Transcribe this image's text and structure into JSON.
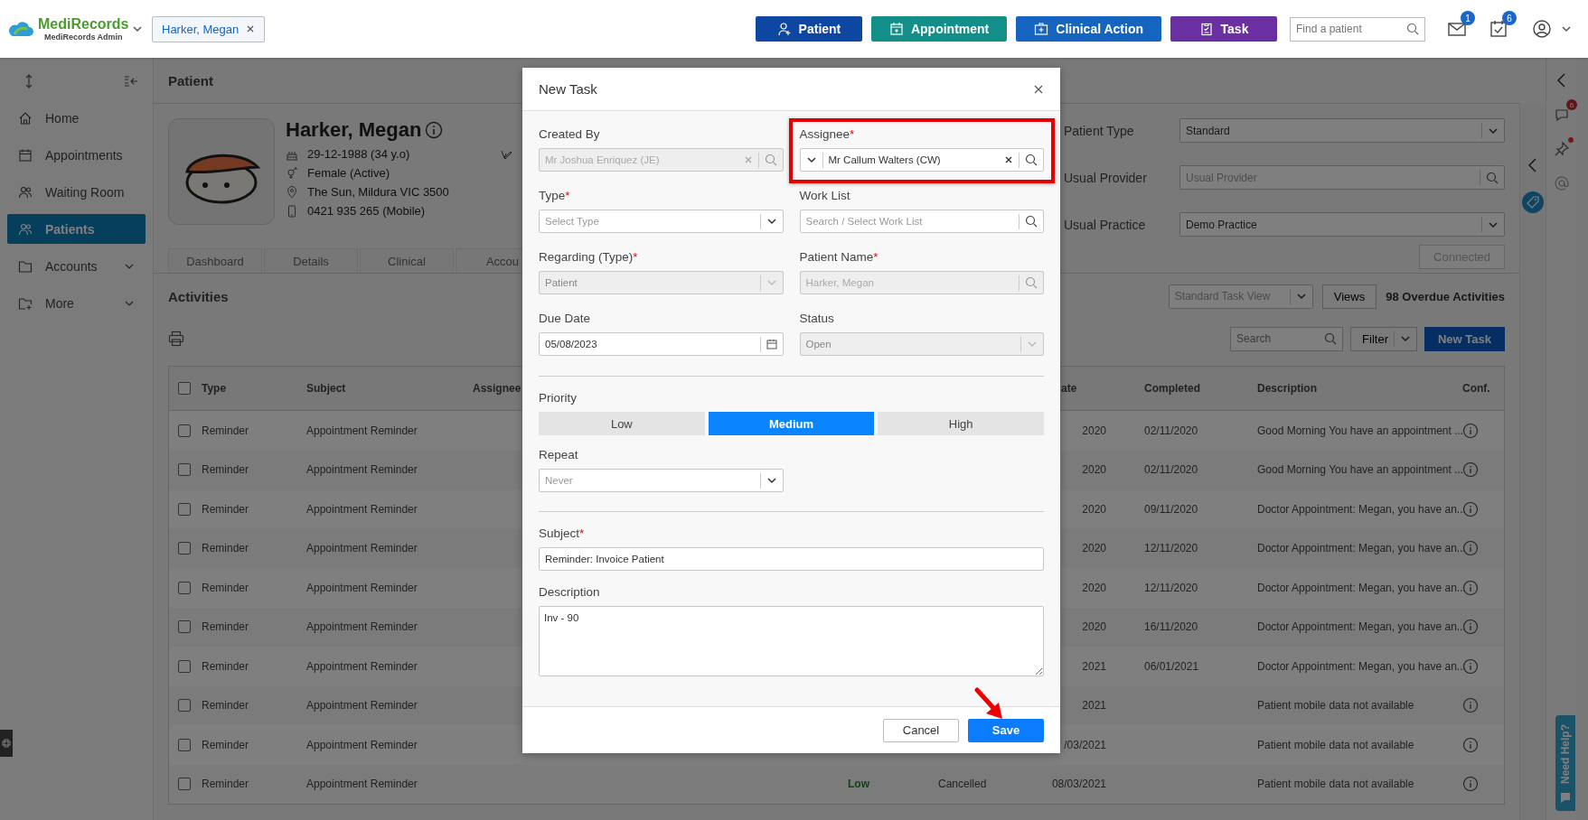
{
  "app": {
    "brand": "MediRecords",
    "subtitle": "MediRecords Admin"
  },
  "open_patient_tab": {
    "label": "Harker, Megan"
  },
  "quick_actions": [
    {
      "label": "Patient",
      "kind": "patient",
      "color": "#0d47a1"
    },
    {
      "label": "Appointment",
      "kind": "appointment",
      "color": "#138f8a"
    },
    {
      "label": "Clinical Action",
      "kind": "clinical",
      "color": "#1565c0"
    },
    {
      "label": "Task",
      "kind": "task",
      "color": "#6a2fa0"
    }
  ],
  "patient_search": {
    "placeholder": "Find a patient"
  },
  "notifications": [
    {
      "kind": "mail",
      "count": "1"
    },
    {
      "kind": "tasks",
      "count": "6"
    }
  ],
  "sidebar": {
    "items": [
      {
        "label": "Home",
        "kind": "home",
        "selected": false,
        "expandable": false
      },
      {
        "label": "Appointments",
        "kind": "calendar",
        "selected": false,
        "expandable": false
      },
      {
        "label": "Waiting Room",
        "kind": "people",
        "selected": false,
        "expandable": false
      },
      {
        "label": "Patients",
        "kind": "patients",
        "selected": true,
        "expandable": false
      },
      {
        "label": "Accounts",
        "kind": "folder",
        "selected": false,
        "expandable": true
      },
      {
        "label": "More",
        "kind": "more",
        "selected": false,
        "expandable": true
      }
    ]
  },
  "page_title": "Patient",
  "patient": {
    "name": "Harker, Megan",
    "details": [
      {
        "kind": "dob",
        "text": "29-12-1988 (34 y.o)"
      },
      {
        "kind": "gender",
        "text": "Female (Active)"
      },
      {
        "kind": "address",
        "text": "The Sun, Mildura VIC 3500"
      },
      {
        "kind": "phone",
        "text": "0421 935 265 (Mobile)"
      }
    ]
  },
  "patient_settings": [
    {
      "label": "Patient Type",
      "kind": "select",
      "value": "Standard"
    },
    {
      "label": "Usual Provider",
      "kind": "lookup",
      "placeholder": "Usual Provider"
    },
    {
      "label": "Usual Practice",
      "kind": "select",
      "value": "Demo Practice"
    }
  ],
  "connection_button": {
    "label": "Connected",
    "disabled": true
  },
  "tabs": [
    {
      "label": "Dashboard",
      "selected": false
    },
    {
      "label": "Details",
      "selected": false
    },
    {
      "label": "Clinical",
      "selected": false
    },
    {
      "label": "Accou",
      "selected": false
    }
  ],
  "activities": {
    "title": "Activities",
    "view_select": {
      "placeholder": "Standard Task View"
    },
    "views_button": "Views",
    "overdue": "98 Overdue Activities",
    "search": {
      "placeholder": "Search"
    },
    "filter_button": "Filter",
    "new_task_button": "New Task"
  },
  "table": {
    "columns": {
      "type": "Type",
      "subject": "Subject",
      "assignee": "Assignee",
      "due": "ate",
      "completed": "Completed",
      "description": "Description",
      "conf": "Conf."
    },
    "header_checked": false,
    "rows": [
      {
        "checked": false,
        "type": "Reminder",
        "subject": "Appointment Reminder",
        "due": "2020",
        "completed": "02/11/2020",
        "description": "Good Morning You have an appointment ..."
      },
      {
        "checked": false,
        "type": "Reminder",
        "subject": "Appointment Reminder",
        "due": "2020",
        "completed": "02/11/2020",
        "description": "Good Morning You have an appointment ..."
      },
      {
        "checked": false,
        "type": "Reminder",
        "subject": "Appointment Reminder",
        "due": "2020",
        "completed": "09/11/2020",
        "description": "Doctor Appointment: Megan, you have an..."
      },
      {
        "checked": false,
        "type": "Reminder",
        "subject": "Appointment Reminder",
        "due": "2020",
        "completed": "12/11/2020",
        "description": "Doctor Appointment: Megan, you have an..."
      },
      {
        "checked": false,
        "type": "Reminder",
        "subject": "Appointment Reminder",
        "due": "2020",
        "completed": "12/11/2020",
        "description": "Doctor Appointment: Megan, you have an..."
      },
      {
        "checked": false,
        "type": "Reminder",
        "subject": "Appointment Reminder",
        "due": "2020",
        "completed": "16/11/2020",
        "description": "Doctor Appointment: Megan, you have an..."
      },
      {
        "checked": false,
        "type": "Reminder",
        "subject": "Appointment Reminder",
        "due": "2021",
        "completed": "06/01/2021",
        "description": "Doctor Appointment: Megan, you have an..."
      },
      {
        "checked": false,
        "type": "Reminder",
        "subject": "Appointment Reminder",
        "due": "2021",
        "description": "Patient mobile data not available"
      },
      {
        "checked": false,
        "type": "Reminder",
        "subject": "Appointment Reminder",
        "due": "/03/2021",
        "description": "Patient mobile data not available"
      },
      {
        "checked": false,
        "type": "Reminder",
        "subject": "Appointment Reminder",
        "priority": "Low",
        "status": "Cancelled",
        "due": "08/03/2021",
        "description": "Patient mobile data not available"
      }
    ]
  },
  "right_panel": {
    "messages_count": "6",
    "pin_alert": true
  },
  "help_tab": {
    "label": "Need Help?"
  },
  "dialog": {
    "title": "New Task",
    "fields": [
      {
        "label": "Created By",
        "kind": "lookup",
        "value": "Mr Joshua Enriquez (JE)",
        "disabled": true,
        "clearable": true
      },
      {
        "label": "Assignee",
        "mark": "*",
        "kind": "lookup",
        "value": "Mr Callum Walters (CW)",
        "disabled": false,
        "clearable": true,
        "expandable": true,
        "highlighted": true
      },
      {
        "label": "Type",
        "mark": "*",
        "kind": "select",
        "placeholder": "Select Type",
        "disabled": false
      },
      {
        "label": "Work List",
        "kind": "lookup",
        "placeholder": "Search / Select Work List",
        "disabled": false
      },
      {
        "label": "Regarding (Type)",
        "mark": "*",
        "kind": "select",
        "value": "Patient",
        "disabled": true
      },
      {
        "label": "Patient Name",
        "mark": "*",
        "kind": "lookup",
        "value": "Harker, Megan",
        "disabled": true
      },
      {
        "label": "Due Date",
        "kind": "date",
        "value": "05/08/2023",
        "disabled": false
      },
      {
        "label": "Status",
        "kind": "select",
        "value": "Open",
        "disabled": true
      }
    ],
    "priority": {
      "label": "Priority",
      "options": [
        {
          "label": "Low",
          "selected": false
        },
        {
          "label": "Medium",
          "selected": true
        },
        {
          "label": "High",
          "selected": false
        }
      ]
    },
    "repeat": {
      "label": "Repeat",
      "placeholder": "Never"
    },
    "subject": {
      "label": "Subject",
      "mark": "*",
      "value": "Reminder: Invoice Patient"
    },
    "description": {
      "label": "Description",
      "value": "Inv - 90"
    },
    "buttons": [
      {
        "label": "Cancel",
        "kind": "secondary",
        "pointed": false
      },
      {
        "label": "Save",
        "kind": "primary",
        "pointed": true
      }
    ]
  }
}
